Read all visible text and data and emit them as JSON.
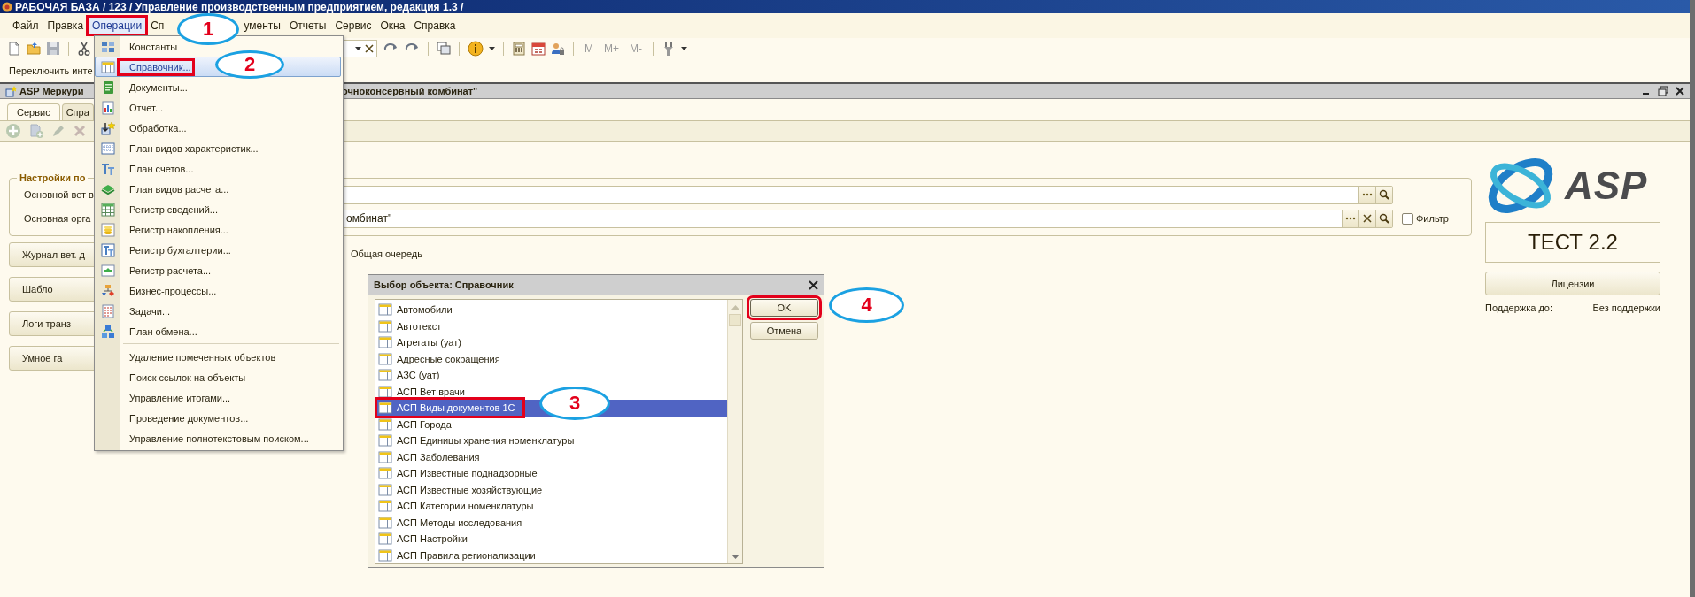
{
  "window": {
    "title": "РАБОЧАЯ БАЗА / 123 / Управление производственным предприятием, редакция 1.3 /"
  },
  "menu_bar": [
    {
      "label": "Файл",
      "selected": false
    },
    {
      "label": "Правка",
      "selected": false
    },
    {
      "label": "Операции",
      "selected": true
    },
    {
      "label": "Сп",
      "selected": false
    },
    {
      "label": "ументы",
      "selected": false
    },
    {
      "label": "Отчеты",
      "selected": false
    },
    {
      "label": "Сервис",
      "selected": false
    },
    {
      "label": "Окна",
      "selected": false
    },
    {
      "label": "Справка",
      "selected": false
    }
  ],
  "toolbar": {
    "memory_buttons": [
      "M",
      "M+",
      "M-"
    ]
  },
  "interface_switch": "Переключить инте",
  "document_window": {
    "title": "ASP Меркури",
    "title_tail": "очноконсервный комбинат\"",
    "tabs": [
      {
        "label": "Сервис",
        "selected": true
      },
      {
        "label": "Спра",
        "selected": false
      }
    ],
    "settings": {
      "title": "Настройки по",
      "fields": [
        {
          "label": "Основной вет в",
          "clearable": false
        },
        {
          "label": "Основная орга",
          "value": "омбинат\"",
          "clearable": true
        }
      ]
    },
    "filter": {
      "label": "Фильтр",
      "checked": false
    },
    "actions": [
      "Журнал вет. д",
      "Шабло",
      "Логи транз",
      "Умное га"
    ],
    "queue_label": "Общая очередь",
    "brand": {
      "logo_text": "ASP",
      "version": "ТЕСТ 2.2",
      "licenses_button": "Лицензии",
      "support_label": "Поддержка до:",
      "support_value": "Без поддержки"
    }
  },
  "operations_menu": {
    "groups": [
      [
        {
          "label": "Константы",
          "selected": false
        },
        {
          "label": "Справочник...",
          "selected": true
        },
        {
          "label": "Документы...",
          "selected": false
        },
        {
          "label": "Отчет...",
          "selected": false
        },
        {
          "label": "Обработка...",
          "selected": false
        },
        {
          "label": "План видов характеристик...",
          "selected": false
        },
        {
          "label": "План счетов...",
          "selected": false
        },
        {
          "label": "План видов расчета...",
          "selected": false
        },
        {
          "label": "Регистр сведений...",
          "selected": false
        },
        {
          "label": "Регистр накопления...",
          "selected": false
        },
        {
          "label": "Регистр бухгалтерии...",
          "selected": false
        },
        {
          "label": "Регистр расчета...",
          "selected": false
        },
        {
          "label": "Бизнес-процессы...",
          "selected": false
        },
        {
          "label": "Задачи...",
          "selected": false
        },
        {
          "label": "План обмена...",
          "selected": false
        }
      ],
      [
        {
          "label": "Удаление помеченных объектов",
          "selected": false
        },
        {
          "label": "Поиск ссылок на объекты",
          "selected": false
        },
        {
          "label": "Управление итогами...",
          "selected": false
        },
        {
          "label": "Проведение документов...",
          "selected": false
        },
        {
          "label": "Управление полнотекстовым поиском...",
          "selected": false
        }
      ]
    ]
  },
  "dialog": {
    "title": "Выбор объекта: Справочник",
    "items": [
      {
        "label": "Автомобили",
        "selected": false
      },
      {
        "label": "Автотекст",
        "selected": false
      },
      {
        "label": "Агрегаты (уат)",
        "selected": false
      },
      {
        "label": "Адресные сокращения",
        "selected": false
      },
      {
        "label": "АЗС (уат)",
        "selected": false
      },
      {
        "label": "АСП Вет врачи",
        "selected": false
      },
      {
        "label": "АСП Виды документов 1С",
        "selected": true
      },
      {
        "label": "АСП Города",
        "selected": false
      },
      {
        "label": "АСП Единицы хранения номенклатуры",
        "selected": false
      },
      {
        "label": "АСП Заболевания",
        "selected": false
      },
      {
        "label": "АСП Известные поднадзорные",
        "selected": false
      },
      {
        "label": "АСП Известные хозяйствующие",
        "selected": false
      },
      {
        "label": "АСП Категории номенклатуры",
        "selected": false
      },
      {
        "label": "АСП Методы исследования",
        "selected": false
      },
      {
        "label": "АСП Настройки",
        "selected": false
      },
      {
        "label": "АСП Правила регионализации",
        "selected": false
      }
    ],
    "buttons": [
      {
        "label": "OK",
        "highlighted": true
      },
      {
        "label": "Отмена",
        "highlighted": false
      }
    ]
  },
  "annotations": [
    {
      "label": "1"
    },
    {
      "label": "2"
    },
    {
      "label": "3"
    },
    {
      "label": "4"
    }
  ]
}
